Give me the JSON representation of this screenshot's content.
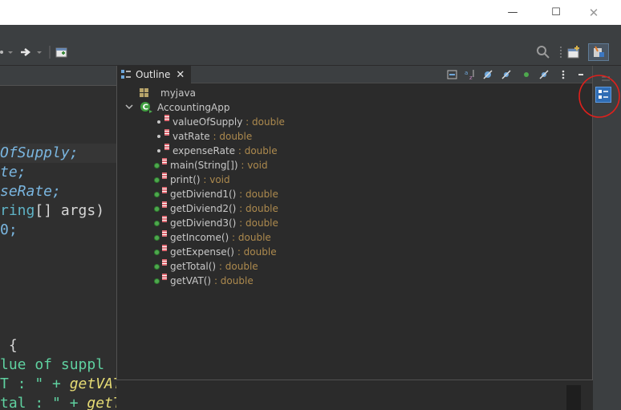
{
  "window": {
    "minimize_glyph": "—",
    "maximize_glyph": "☐",
    "close_glyph": "✕"
  },
  "editor": {
    "lines": [
      {
        "text": "OfSupply;",
        "color": "#7ab6e0",
        "italic": true,
        "suffix": ""
      },
      {
        "text": "te;",
        "color": "#7ab6e0",
        "italic": true,
        "suffix": ""
      },
      {
        "text": "seRate;",
        "color": "#7ab6e0",
        "italic": true,
        "suffix": ""
      },
      {
        "text": "ring",
        "color": "#5fb3c6",
        "italic": false,
        "suffix": "[] args)"
      },
      {
        "text": "0;",
        "color": "#7ab6e0",
        "italic": false,
        "suffix": ""
      },
      {
        "text": " {",
        "color": "#d6d6d6",
        "italic": false,
        "suffix": ""
      },
      {
        "text": "lue of suppl",
        "color": "#5fd1a0",
        "italic": false,
        "suffix": ""
      },
      {
        "text": "T : \" + ",
        "color": "#5fd1a0",
        "italic": false,
        "suffix": "getVAT());"
      },
      {
        "text": "tal : \" + ",
        "color": "#5fd1a0",
        "italic": false,
        "suffix": "getTotal());"
      }
    ]
  },
  "outline": {
    "tab_label": "Outline",
    "close_glyph": "✕",
    "package": "myjava",
    "class_name": "AccountingApp",
    "members": [
      {
        "name": "valueOfSupply",
        "type": " : double",
        "kind": "field"
      },
      {
        "name": "vatRate",
        "type": " : double",
        "kind": "field"
      },
      {
        "name": "expenseRate",
        "type": " : double",
        "kind": "field"
      },
      {
        "name": "main(String[])",
        "type": " : void",
        "kind": "method"
      },
      {
        "name": "print()",
        "type": " : void",
        "kind": "method"
      },
      {
        "name": "getDiviend1()",
        "type": " : double",
        "kind": "method"
      },
      {
        "name": "getDiviend2()",
        "type": " : double",
        "kind": "method"
      },
      {
        "name": "getDiviend3()",
        "type": " : double",
        "kind": "method"
      },
      {
        "name": "getIncome()",
        "type": " : double",
        "kind": "method"
      },
      {
        "name": "getExpense()",
        "type": " : double",
        "kind": "method"
      },
      {
        "name": "getTotal()",
        "type": " : double",
        "kind": "method"
      },
      {
        "name": "getVAT()",
        "type": " : double",
        "kind": "method"
      }
    ]
  },
  "colors": {
    "accent_blue": "#2f6db5",
    "annotation_red": "#e0201c",
    "method_green": "#4ea84e",
    "type_gold": "#ad8a4e"
  }
}
